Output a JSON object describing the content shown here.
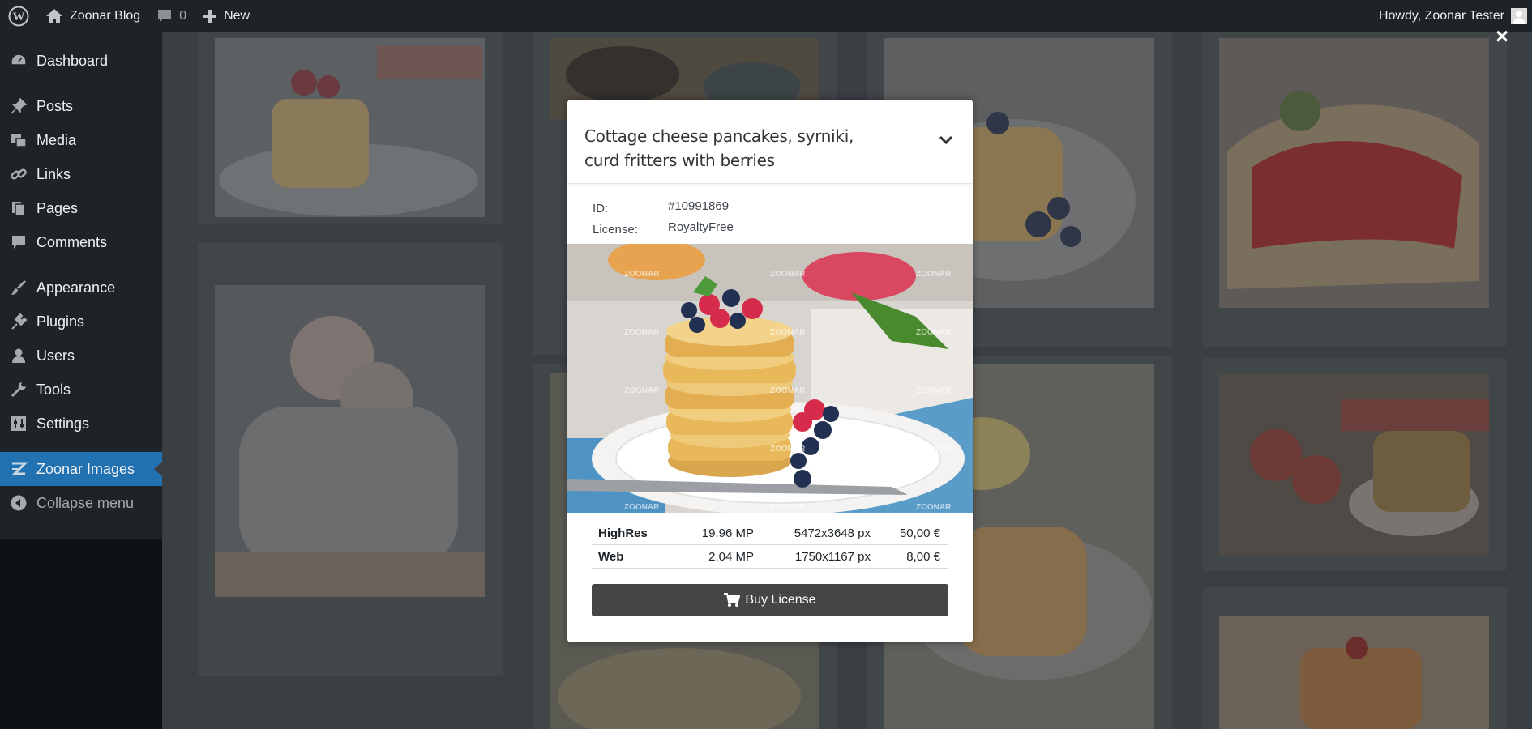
{
  "adminbar": {
    "site_name": "Zoonar Blog",
    "comments_count": "0",
    "new_label": "New",
    "greeting": "Howdy, Zoonar Tester"
  },
  "sidebar": {
    "items": [
      {
        "label": "Dashboard",
        "icon": "dashboard-icon"
      },
      {
        "label": "Posts",
        "icon": "pin-icon"
      },
      {
        "label": "Media",
        "icon": "media-icon"
      },
      {
        "label": "Links",
        "icon": "link-icon"
      },
      {
        "label": "Pages",
        "icon": "pages-icon"
      },
      {
        "label": "Comments",
        "icon": "comment-icon"
      },
      {
        "label": "Appearance",
        "icon": "brush-icon"
      },
      {
        "label": "Plugins",
        "icon": "plugin-icon"
      },
      {
        "label": "Users",
        "icon": "user-icon"
      },
      {
        "label": "Tools",
        "icon": "wrench-icon"
      },
      {
        "label": "Settings",
        "icon": "settings-icon"
      },
      {
        "label": "Zoonar Images",
        "icon": "zoonar-icon",
        "active": true
      },
      {
        "label": "Collapse menu",
        "icon": "collapse-icon"
      }
    ]
  },
  "modal": {
    "title": "Cottage cheese pancakes, syrniki, curd fritters with berries",
    "id_label": "ID:",
    "id_value": "#10991869",
    "license_label": "License:",
    "license_value": "RoyaltyFree",
    "watermark": "ZOONAR",
    "prices": [
      {
        "name": "HighRes",
        "mp": "19.96 MP",
        "dims": "5472x3648 px",
        "price": "50,00 €"
      },
      {
        "name": "Web",
        "mp": "2.04 MP",
        "dims": "1750x1167 px",
        "price": "8,00 €"
      }
    ],
    "buy_label": "Buy License"
  },
  "colors": {
    "adminbar_bg": "#1d2327",
    "active_menu": "#2271b1",
    "buy_button": "#454545"
  }
}
